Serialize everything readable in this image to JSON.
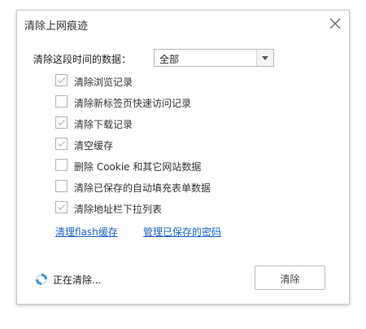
{
  "dialog": {
    "title": "清除上网痕迹",
    "close_icon": "close-icon"
  },
  "time_range": {
    "label": "清除这段时间的数据：",
    "selected": "全部"
  },
  "options": [
    {
      "label": "清除浏览记录",
      "checked": true,
      "disabled": true
    },
    {
      "label": "清除新标签页快速访问记录",
      "checked": false,
      "disabled": false
    },
    {
      "label": "清除下载记录",
      "checked": true,
      "disabled": true
    },
    {
      "label": "清空缓存",
      "checked": true,
      "disabled": true
    },
    {
      "label": "删除 Cookie 和其它网站数据",
      "checked": false,
      "disabled": false
    },
    {
      "label": "清除已保存的自动填充表单数据",
      "checked": false,
      "disabled": false
    },
    {
      "label": "清除地址栏下拉列表",
      "checked": true,
      "disabled": true
    }
  ],
  "links": {
    "flash": "清理flash缓存",
    "passwords": "管理已保存的密码"
  },
  "footer": {
    "status": "正在清除...",
    "button": "清除"
  },
  "colors": {
    "link": "#1a62c8",
    "spinner": "#3b8fd8",
    "border": "#c9c9c9"
  }
}
